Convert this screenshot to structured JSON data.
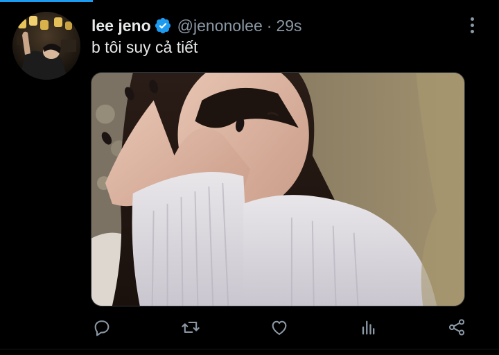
{
  "tweet": {
    "display_name": "lee jeno",
    "handle": "@jenonolee",
    "separator": "·",
    "timestamp": "29s",
    "text": "b tôi suy cả tiết",
    "verified": true
  },
  "icons": {
    "verified": "verified-badge-icon",
    "more": "more-options-icon",
    "reply": "reply-icon",
    "retweet": "retweet-icon",
    "like": "like-icon",
    "analytics": "analytics-icon",
    "share": "share-icon"
  },
  "colors": {
    "background": "#000000",
    "accent": "#1d9bf0",
    "primary_text": "#e7e9ea",
    "secondary_text": "#8b98a5"
  }
}
